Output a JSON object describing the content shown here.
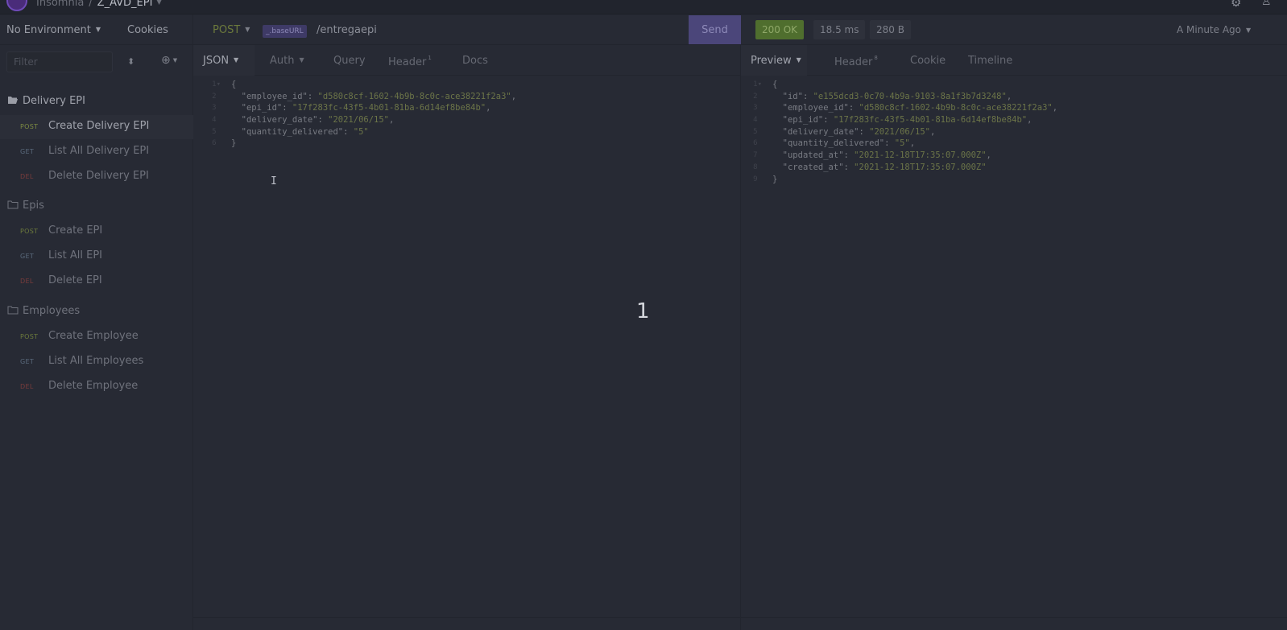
{
  "app": {
    "name": "Insomnia",
    "workspace": "Z_AVD_EPI"
  },
  "sidebar": {
    "environment": "No Environment",
    "cookies": "Cookies",
    "filter_placeholder": "Filter",
    "folders": [
      {
        "name": "Delivery EPI",
        "open": true,
        "requests": [
          {
            "method": "POST",
            "name": "Create Delivery EPI",
            "active": true
          },
          {
            "method": "GET",
            "name": "List All Delivery EPI"
          },
          {
            "method": "DEL",
            "name": "Delete Delivery EPI"
          }
        ]
      },
      {
        "name": "Epis",
        "requests": [
          {
            "method": "POST",
            "name": "Create EPI"
          },
          {
            "method": "GET",
            "name": "List All EPI"
          },
          {
            "method": "DEL",
            "name": "Delete EPI"
          }
        ]
      },
      {
        "name": "Employees",
        "requests": [
          {
            "method": "POST",
            "name": "Create Employee"
          },
          {
            "method": "GET",
            "name": "List All Employees"
          },
          {
            "method": "DEL",
            "name": "Delete Employee"
          }
        ]
      }
    ]
  },
  "request": {
    "method": "POST",
    "url_var": "_.baseURL",
    "url_path": "/entregaepi",
    "send_label": "Send",
    "tabs": [
      {
        "label": "JSON",
        "selected": true,
        "dropdown": true
      },
      {
        "label": "Auth",
        "dropdown": true
      },
      {
        "label": "Query"
      },
      {
        "label": "Header",
        "badge": "1"
      },
      {
        "label": "Docs"
      }
    ],
    "body_lines": [
      "{",
      "  \"employee_id\": \"d580c8cf-1602-4b9b-8c0c-ace38221f2a3\",",
      "  \"epi_id\": \"17f283fc-43f5-4b01-81ba-6d14ef8be84b\",",
      "  \"delivery_date\": \"2021/06/15\",",
      "  \"quantity_delivered\": \"5\"",
      "}"
    ]
  },
  "response": {
    "status": "200 OK",
    "time": "18.5 ms",
    "size": "280 B",
    "ago": "A Minute Ago",
    "tabs": [
      {
        "label": "Preview",
        "selected": true,
        "dropdown": true
      },
      {
        "label": "Header",
        "badge": "8"
      },
      {
        "label": "Cookie"
      },
      {
        "label": "Timeline"
      }
    ],
    "body_lines": [
      "{",
      "  \"id\": \"e155dcd3-0c70-4b9a-9103-8a1f3b7d3248\",",
      "  \"employee_id\": \"d580c8cf-1602-4b9b-8c0c-ace38221f2a3\",",
      "  \"epi_id\": \"17f283fc-43f5-4b01-81ba-6d14ef8be84b\",",
      "  \"delivery_date\": \"2021/06/15\",",
      "  \"quantity_delivered\": \"5\",",
      "  \"updated_at\": \"2021-12-18T17:35:07.000Z\",",
      "  \"created_at\": \"2021-12-18T17:35:07.000Z\"",
      "}"
    ]
  },
  "overlay_number": "1",
  "colors": {
    "background": "#272a34",
    "send": "#4b467a",
    "status_ok": "#4f6e2e",
    "post": "#6c7a3c",
    "delete": "#7a3c3c"
  }
}
